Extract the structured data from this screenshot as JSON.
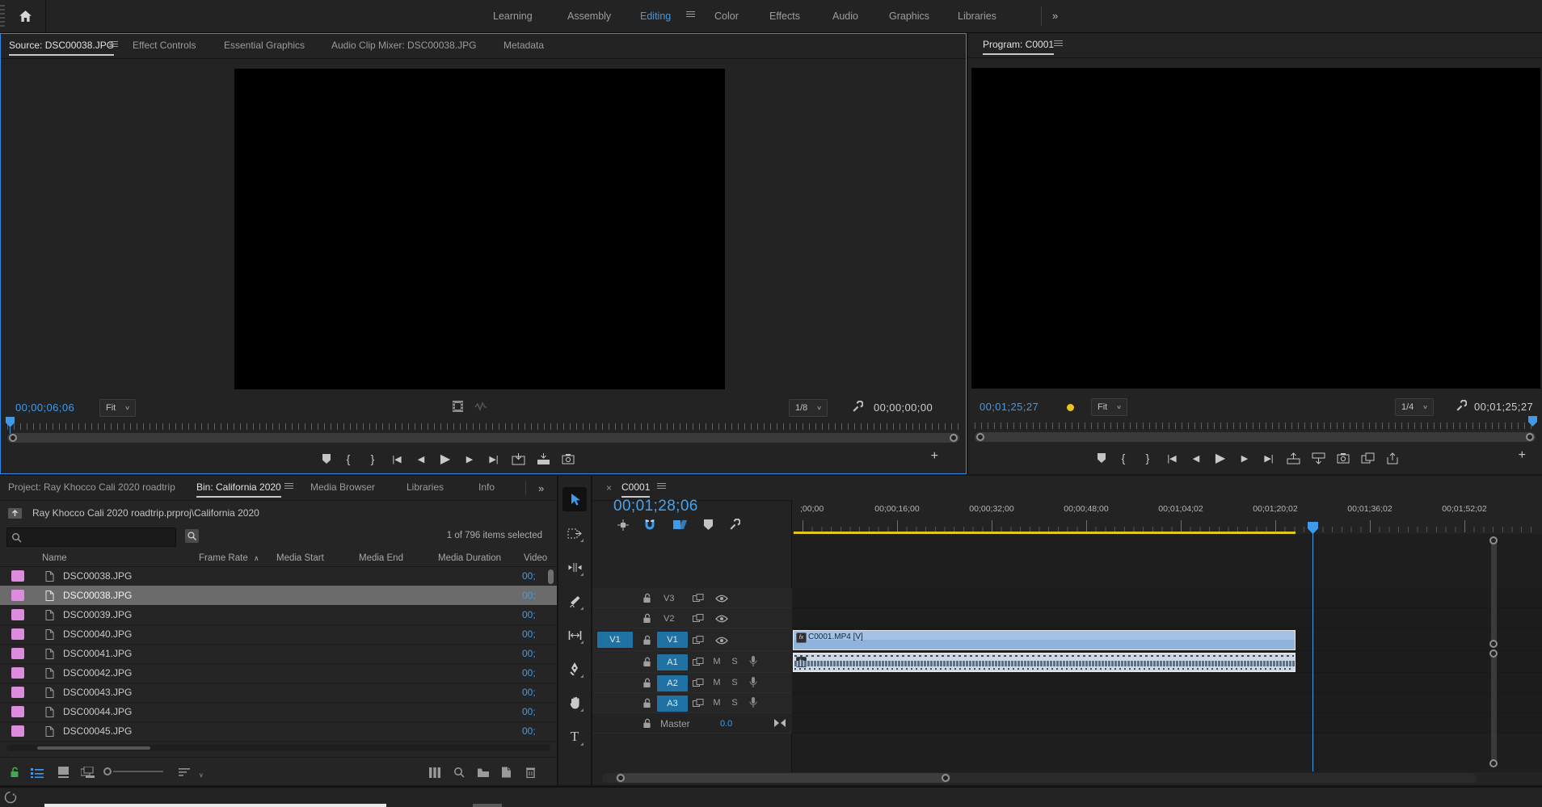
{
  "icons": {
    "overflow": "»",
    "close": "×",
    "chevron_down": "∨",
    "sort_ascending": "∧",
    "mark_in": "{",
    "mark_out": "}",
    "go_to_in": "|◀",
    "step_back": "◀",
    "play": "▶",
    "step_forward": "▶",
    "go_to_out": "▶|",
    "add": "+",
    "mute": "M",
    "solo": "S",
    "type_tool": "T"
  },
  "colors": {
    "accent_blue": "#3f9bea",
    "focus_border": "#2d8ceb",
    "track_target_blue": "#2172a4",
    "clip_blue": "#8fb3da",
    "label_pink": "#dd8bdd",
    "work_area_yellow": "#dfc71f",
    "resolution_dot_yellow": "#e8c21e",
    "lock_green": "#3faa4e"
  },
  "topbar": {
    "tabs": [
      "Learning",
      "Assembly",
      "Editing",
      "Color",
      "Effects",
      "Audio",
      "Graphics",
      "Libraries"
    ],
    "active_tab": "Editing"
  },
  "source_monitor": {
    "tabs": [
      "Source: DSC00038.JPG",
      "Effect Controls",
      "Essential Graphics",
      "Audio Clip Mixer: DSC00038.JPG",
      "Metadata"
    ],
    "active_tab": "Source: DSC00038.JPG",
    "position_timecode": "00;00;06;06",
    "zoom_level": "Fit",
    "playback_resolution": "1/8",
    "in_out_duration": "00;00;00;00"
  },
  "program_monitor": {
    "tab": "Program: C0001",
    "position_timecode": "00;01;25;27",
    "zoom_level": "Fit",
    "playback_resolution": "1/4",
    "in_out_duration": "00;01;25;27"
  },
  "project_panel": {
    "tabs": [
      "Project: Ray Khocco Cali 2020 roadtrip",
      "Bin: California 2020",
      "Media Browser",
      "Libraries",
      "Info"
    ],
    "active_tab": "Bin: California 2020",
    "breadcrumb": "Ray Khocco Cali 2020 roadtrip.prproj\\California 2020",
    "selection_status": "1 of 796 items selected",
    "columns": [
      "Name",
      "Frame Rate",
      "Media Start",
      "Media End",
      "Media Duration",
      "Video"
    ],
    "sorted_column": "Frame Rate",
    "rows": [
      {
        "name": "DSC00038.JPG",
        "video": "00;",
        "selected": false
      },
      {
        "name": "DSC00038.JPG",
        "video": "00;",
        "selected": true
      },
      {
        "name": "DSC00039.JPG",
        "video": "00;",
        "selected": false
      },
      {
        "name": "DSC00040.JPG",
        "video": "00;",
        "selected": false
      },
      {
        "name": "DSC00041.JPG",
        "video": "00;",
        "selected": false
      },
      {
        "name": "DSC00042.JPG",
        "video": "00;",
        "selected": false
      },
      {
        "name": "DSC00043.JPG",
        "video": "00;",
        "selected": false
      },
      {
        "name": "DSC00044.JPG",
        "video": "00;",
        "selected": false
      },
      {
        "name": "DSC00045.JPG",
        "video": "00;",
        "selected": false
      }
    ]
  },
  "timeline": {
    "tab": "C0001",
    "position_timecode": "00;01;28;06",
    "ruler_labels": [
      ";00;00",
      "00;00;16;00",
      "00;00;32;00",
      "00;00;48;00",
      "00;01;04;02",
      "00;01;20;02",
      "00;01;36;02",
      "00;01;52;02"
    ],
    "video_tracks": [
      "V3",
      "V2",
      "V1"
    ],
    "source_patch_video": "V1",
    "audio_tracks": [
      "A1",
      "A2",
      "A3"
    ],
    "master_label": "Master",
    "master_gain": "0.0",
    "video_clip_label": "C0001.MP4 [V]",
    "fx_badge": "fx"
  }
}
